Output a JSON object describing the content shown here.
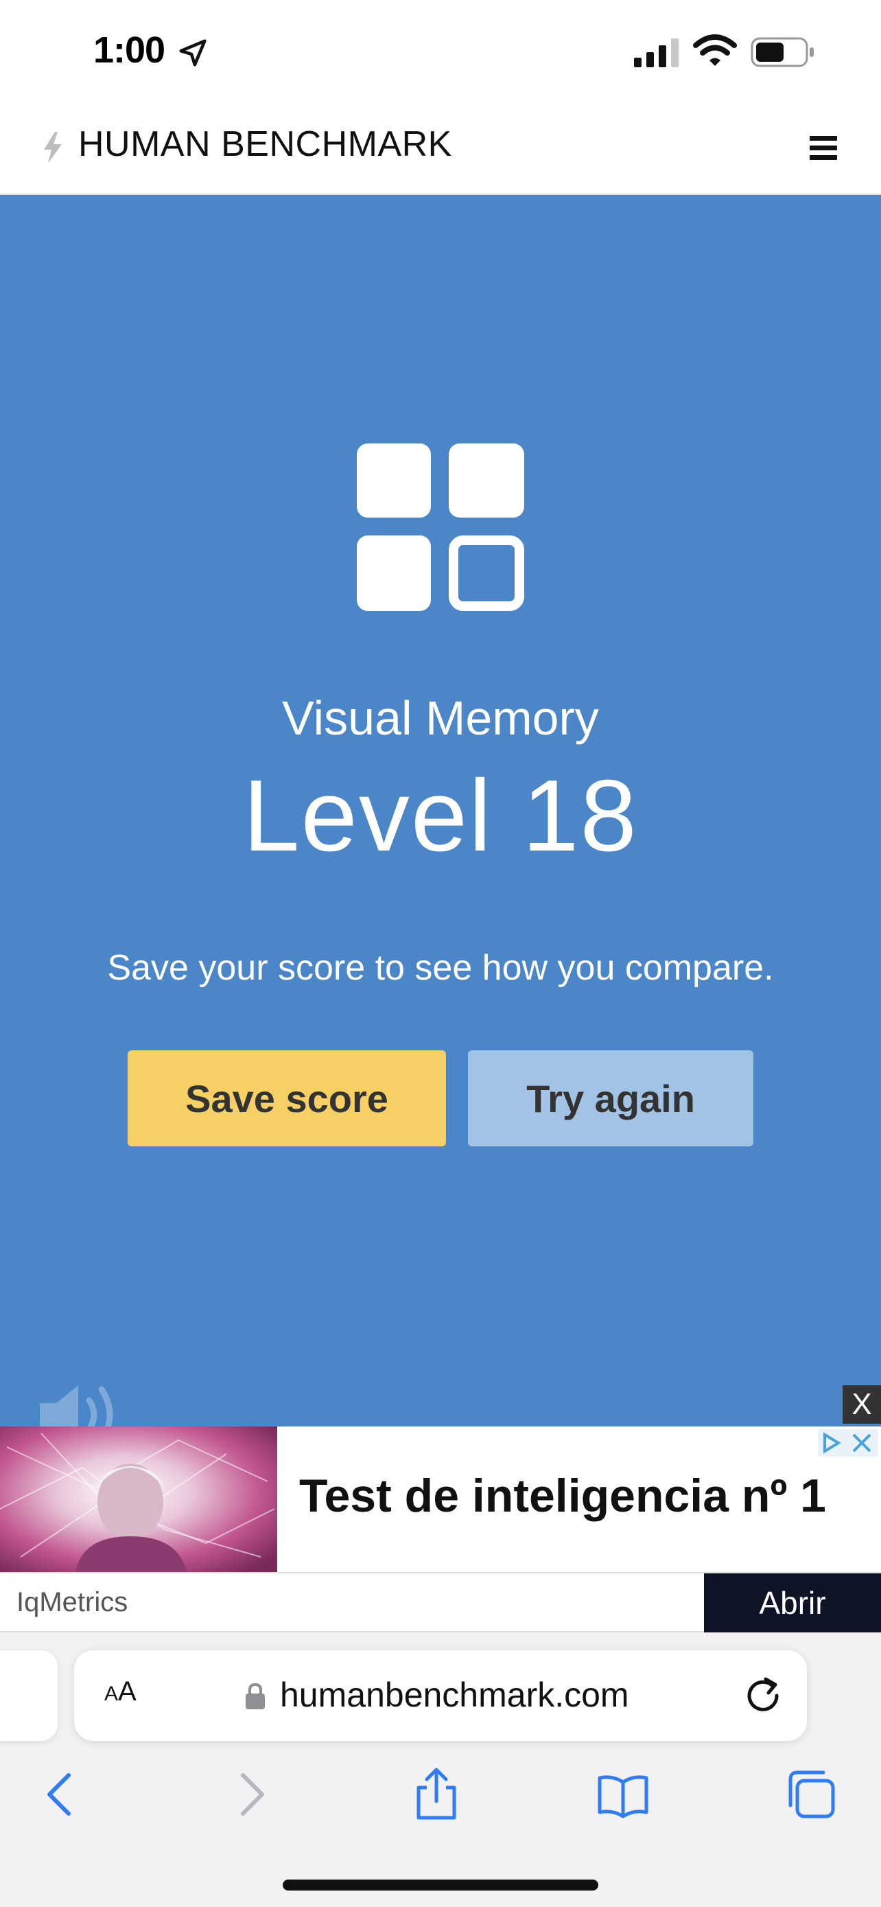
{
  "status_bar": {
    "time": "1:00"
  },
  "header": {
    "brand": "HUMAN BENCHMARK"
  },
  "hero": {
    "test_name": "Visual Memory",
    "result": "Level 18",
    "message": "Save your score to see how you compare.",
    "save_label": "Save score",
    "retry_label": "Try again"
  },
  "ad": {
    "close_label": "X",
    "headline": "Test de inteligencia nº 1",
    "advertiser": "IqMetrics",
    "cta": "Abrir"
  },
  "browser": {
    "text_size_small": "A",
    "text_size_large": "A",
    "url": "humanbenchmark.com"
  },
  "colors": {
    "hero_bg": "#4a86c8",
    "save_button": "#f6d064",
    "retry_button": "#a2c2e6",
    "ad_cta_bg": "#0e1326",
    "safari_blue": "#2f7cf6"
  }
}
